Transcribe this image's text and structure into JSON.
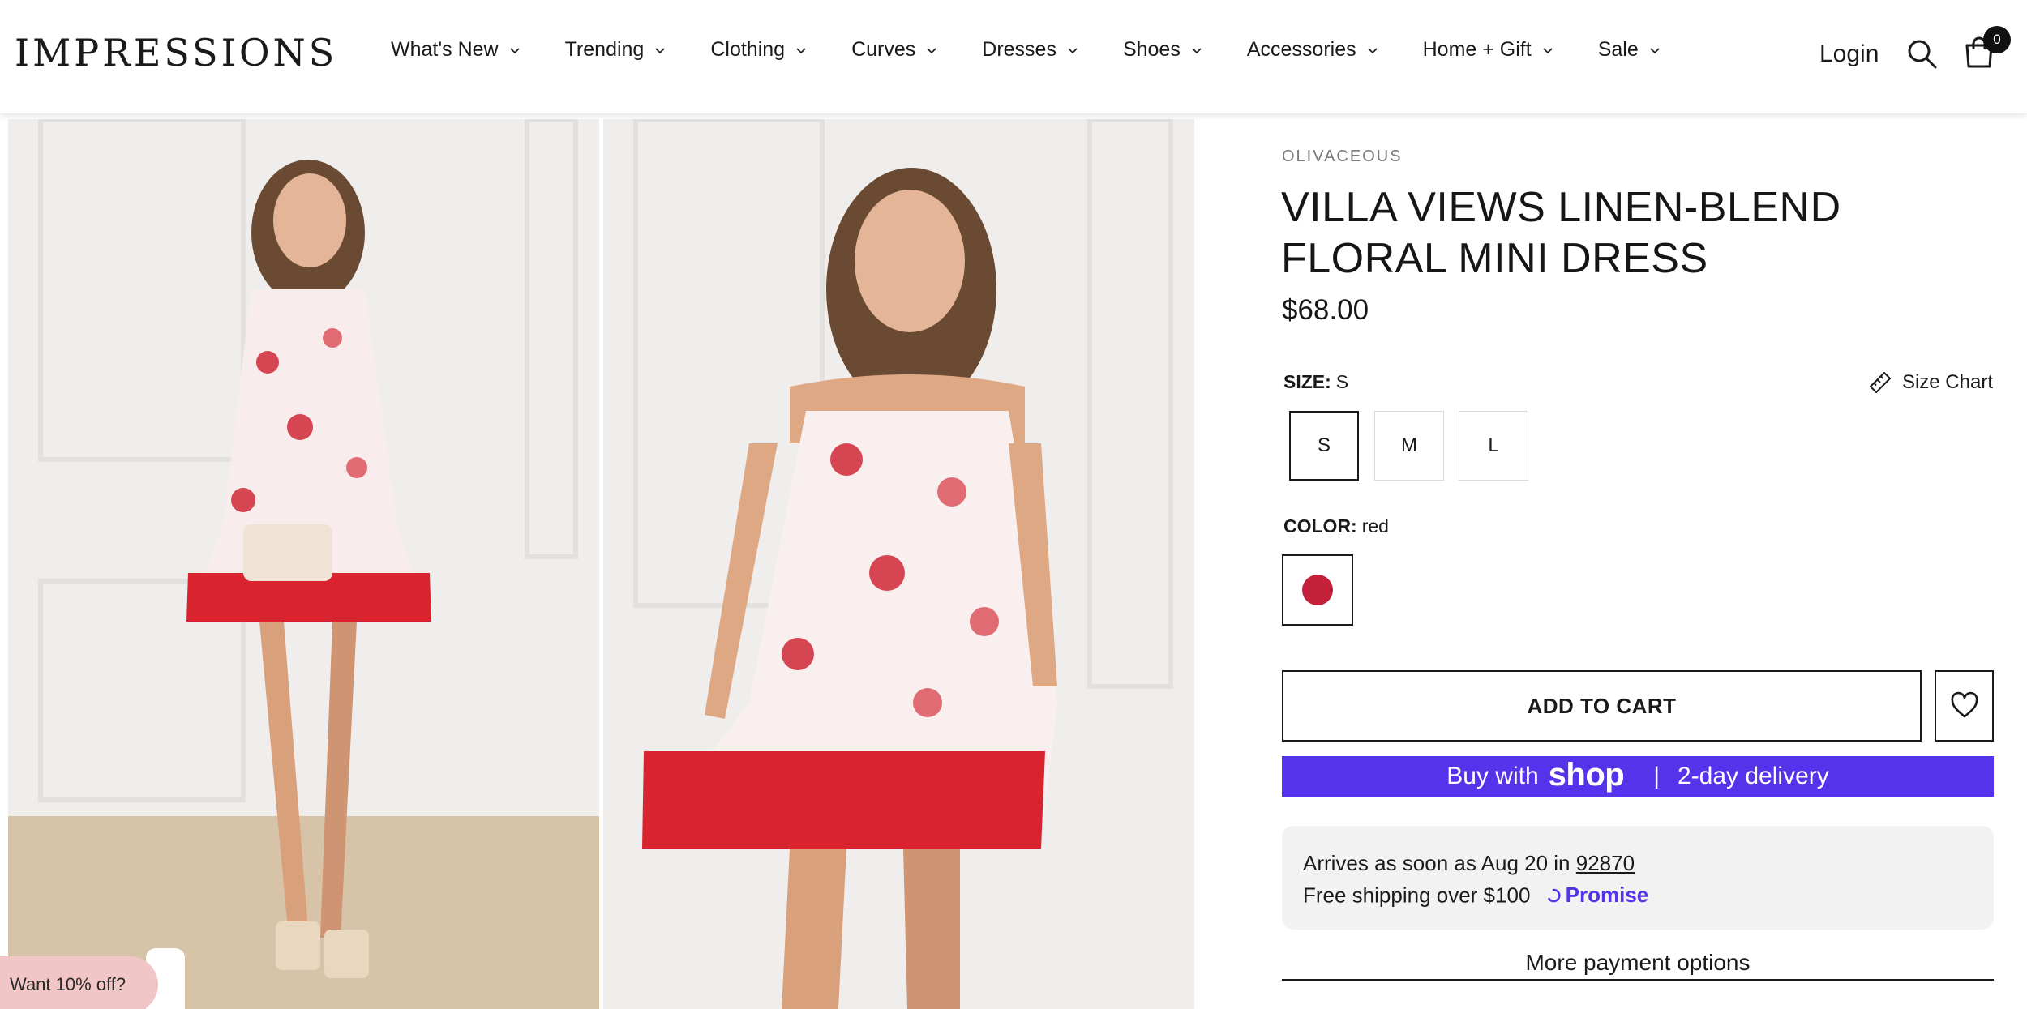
{
  "header": {
    "logo": "IMPRESSIONS",
    "nav": [
      {
        "label": "What's New"
      },
      {
        "label": "Trending"
      },
      {
        "label": "Clothing"
      },
      {
        "label": "Curves"
      },
      {
        "label": "Dresses"
      },
      {
        "label": "Shoes"
      },
      {
        "label": "Accessories"
      },
      {
        "label": "Home + Gift"
      },
      {
        "label": "Sale"
      }
    ],
    "login": "Login",
    "cart_count": "0",
    "icons": [
      "search-icon",
      "bag-icon",
      "chevron-down-icon"
    ]
  },
  "product": {
    "brand": "OLIVACEOUS",
    "title": "VILLA VIEWS LINEN-BLEND FLORAL MINI DRESS",
    "price": "$68.00",
    "size_label": "SIZE:",
    "size_selected": "S",
    "size_chart": "Size Chart",
    "sizes": [
      "S",
      "M",
      "L"
    ],
    "color_label": "COLOR:",
    "color_selected": "red",
    "color_swatch_hex": "#c4223a",
    "add_to_cart": "ADD TO CART",
    "shop_pay": {
      "prefix": "Buy with",
      "brand": "shop",
      "separator": "|",
      "suffix": "2-day delivery",
      "color": "#5433eb"
    },
    "delivery": {
      "arrives": "Arrives as soon as Aug 20 in",
      "zip": "92870",
      "shipping": "Free shipping over $100",
      "promise": "Promise"
    },
    "more_payment": "More payment options"
  },
  "promo": {
    "label": "Want 10% off?"
  }
}
